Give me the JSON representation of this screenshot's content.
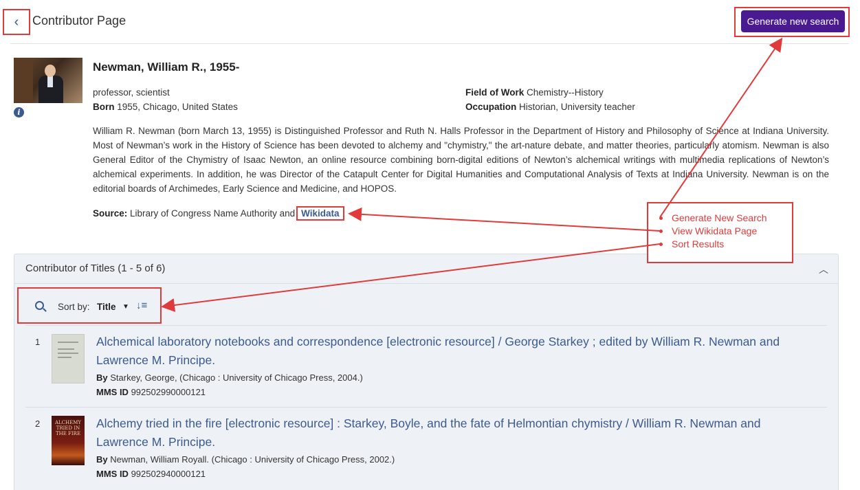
{
  "header": {
    "page_title": "Contributor Page",
    "generate_button": "Generate new search"
  },
  "contributor": {
    "name": "Newman, William R., 1955-",
    "description": "professor, scientist",
    "born_label": "Born",
    "born_value": "1955, Chicago, United States",
    "field_label": "Field of Work",
    "field_value": "Chemistry--History",
    "occupation_label": "Occupation",
    "occupation_value": "Historian, University teacher",
    "bio": "William R. Newman (born March 13, 1955) is Distinguished Professor and Ruth N. Halls Professor in the Department of History and Philosophy of Science at Indiana University. Most of Newman’s work in the History of Science has been devoted to alchemy and \"chymistry,\" the art-nature debate, and matter theories, particularly atomism. Newman is also General Editor of the Chymistry of Isaac Newton, an online resource combining born-digital editions of Newton’s alchemical writings with multimedia replications of Newton’s alchemical experiments. In addition, he was Director of the Catapult Center for Digital Humanities and Computational Analysis of Texts at Indiana University. Newman is on the editorial boards of Archimedes, Early Science and Medicine, and HOPOS.",
    "source_label": "Source:",
    "source_text": "Library of Congress Name Authority and",
    "source_link": "Wikidata"
  },
  "callout": {
    "items": [
      "Generate New Search",
      "View Wikidata Page",
      "Sort Results"
    ]
  },
  "results": {
    "panel_title": "Contributor of Titles (1 - 5 of 6)",
    "sort_label": "Sort by:",
    "sort_value": "Title",
    "by_label": "By",
    "mms_label": "MMS ID",
    "items": [
      {
        "num": "1",
        "title": "Alchemical laboratory notebooks and correspondence [electronic resource] / George Starkey ; edited by William R. Newman and Lawrence M. Principe.",
        "by": "Starkey, George, (Chicago : University of Chicago Press, 2004.)",
        "mms": "992502990000121"
      },
      {
        "num": "2",
        "title": "Alchemy tried in the fire [electronic resource] : Starkey, Boyle, and the fate of Helmontian chymistry / William R. Newman and Lawrence M. Principe.",
        "by": "Newman, William Royall. (Chicago : University of Chicago Press, 2002.)",
        "mms": "992502940000121",
        "cover_text": "ALCHEMY TRIED IN THE FIRE"
      }
    ]
  },
  "colors": {
    "primary_button": "#4a1a91",
    "link": "#3b5a8f",
    "annotation": "#e03a3a"
  }
}
